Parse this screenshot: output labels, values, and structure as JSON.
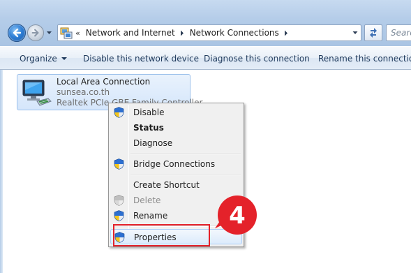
{
  "address": {
    "crumbs": [
      "Network and Internet",
      "Network Connections"
    ],
    "overflow_chevron": "«"
  },
  "search": {
    "placeholder": "Search Network Connections"
  },
  "toolbar": {
    "organize_label": "Organize",
    "disable_label": "Disable this network device",
    "diagnose_label": "Diagnose this connection",
    "rename_label": "Rename this connection"
  },
  "connection": {
    "name": "Local Area Connection",
    "host": "sunsea.co.th",
    "adapter": "Realtek PCIe GBE Family Controller"
  },
  "context_menu": {
    "items": [
      {
        "label": "Disable",
        "shield": true,
        "bold": false,
        "disabled": false
      },
      {
        "label": "Status",
        "shield": false,
        "bold": true,
        "disabled": false
      },
      {
        "label": "Diagnose",
        "shield": false,
        "bold": false,
        "disabled": false
      },
      {
        "label": "Bridge Connections",
        "shield": true,
        "bold": false,
        "disabled": false
      },
      {
        "label": "Create Shortcut",
        "shield": false,
        "bold": false,
        "disabled": false
      },
      {
        "label": "Delete",
        "shield": true,
        "bold": false,
        "disabled": true
      },
      {
        "label": "Rename",
        "shield": true,
        "bold": false,
        "disabled": false
      },
      {
        "label": "Properties",
        "shield": true,
        "bold": false,
        "disabled": false,
        "hover": true
      }
    ]
  },
  "annotation": {
    "step_number": "4",
    "color": "#e4222a"
  }
}
